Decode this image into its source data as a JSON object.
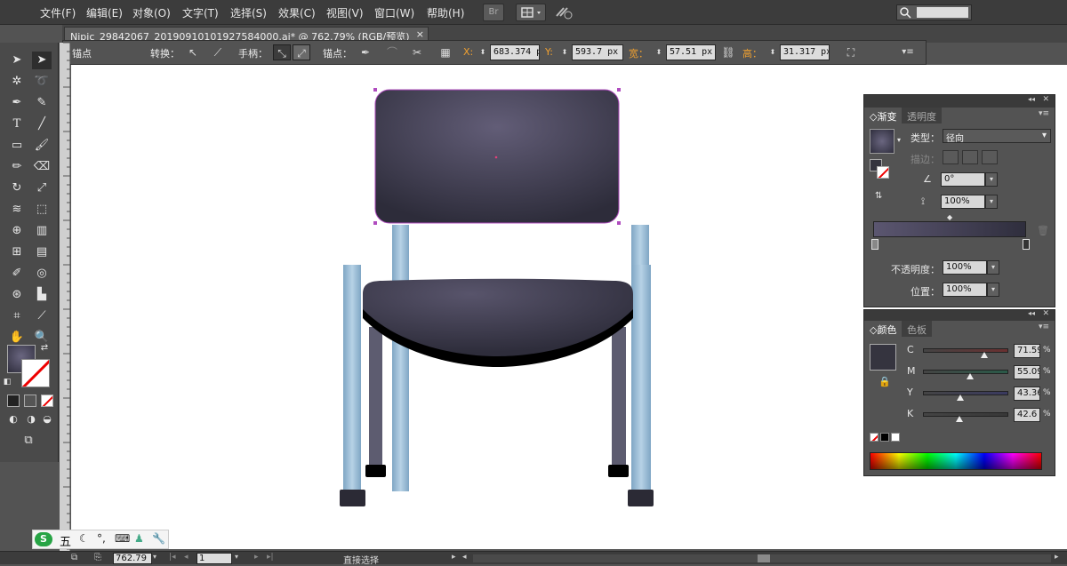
{
  "menubar": {
    "items": [
      "文件(F)",
      "编辑(E)",
      "对象(O)",
      "文字(T)",
      "选择(S)",
      "效果(C)",
      "视图(V)",
      "窗口(W)",
      "帮助(H)"
    ],
    "bridge_label": "Br"
  },
  "document": {
    "tab_title": "Nipic_29842067_20190910101927584000.ai* @ 762.79% (RGB/预览)",
    "close": "×"
  },
  "controlbar": {
    "anchor_label": "锚点",
    "convert_label": "转换：",
    "handles_label": "手柄：",
    "anchors_label": "锚点：",
    "x_label": "X:",
    "x_value": "683.374 p",
    "y_label": "Y:",
    "y_value": "593.7 px",
    "w_label": "宽：",
    "w_value": "57.51 px",
    "h_label": "高：",
    "h_value": "31.317 px"
  },
  "gradient_panel": {
    "tab_active": "渐变",
    "tab_inactive": "透明度",
    "type_label": "类型：",
    "type_value": "径向",
    "stroke_label": "描边：",
    "angle_value": "0°",
    "aspect_value": "100%",
    "opacity_label": "不透明度：",
    "opacity_value": "100%",
    "location_label": "位置：",
    "location_value": "100%",
    "gradient_start": "#5b5670",
    "gradient_end": "#2f2e3d"
  },
  "color_panel": {
    "tab_active": "颜色",
    "tab_inactive": "色板",
    "channels": [
      {
        "label": "C",
        "value": "71.59",
        "unit": "%",
        "level": 0.7159,
        "color": "#6a3030"
      },
      {
        "label": "M",
        "value": "55.09",
        "unit": "%",
        "level": 0.5509,
        "color": "#2a5a48"
      },
      {
        "label": "Y",
        "value": "43.36",
        "unit": "%",
        "level": 0.4336,
        "color": "#3a3a60"
      },
      {
        "label": "K",
        "value": "42.6",
        "unit": "%",
        "level": 0.426,
        "color": "#383838"
      }
    ],
    "swatch_color": "#35343f"
  },
  "statusbar": {
    "zoom": "762.79",
    "page": "1",
    "tool_name": "直接选择"
  },
  "ime": {
    "mode": "五"
  },
  "chair": {
    "back_color_light": "#5f5a74",
    "back_color_dark": "#2d2c3a",
    "leg_color": "#8fb4d1",
    "inner_leg_color": "#5d5c70",
    "foot_color": "#2b2a35"
  }
}
